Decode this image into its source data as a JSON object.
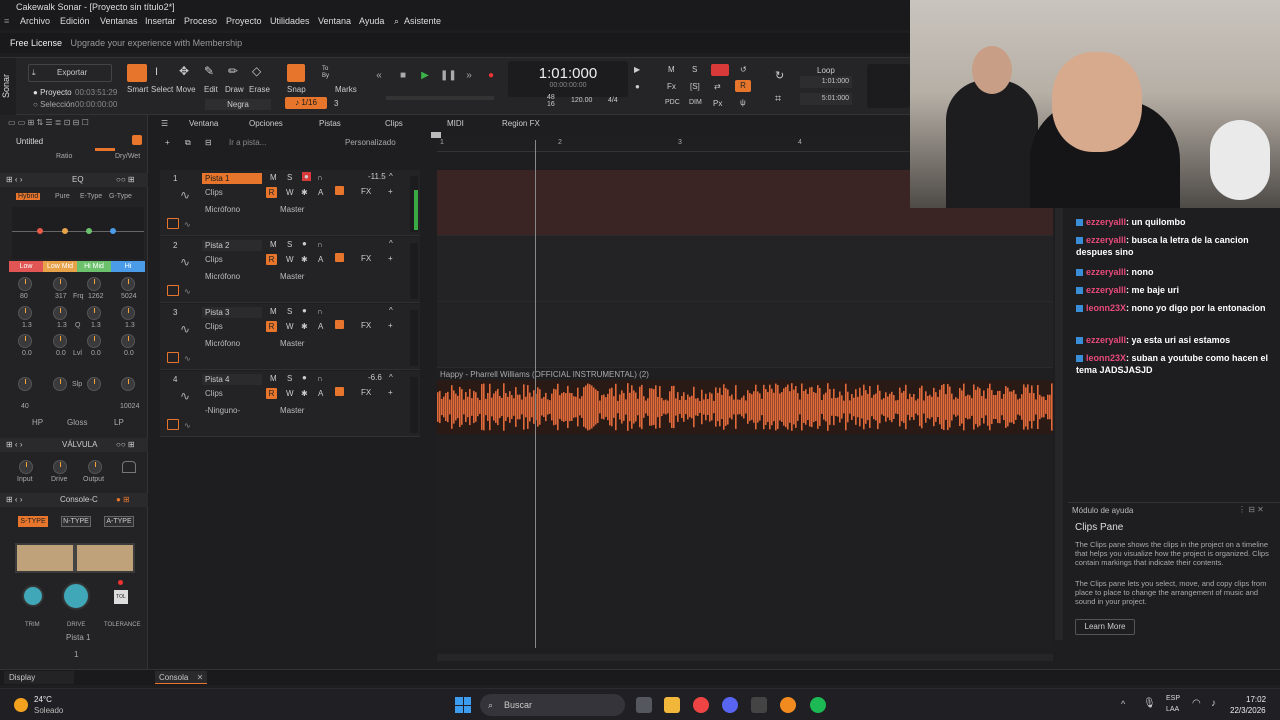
{
  "app": {
    "title": "Cakewalk Sonar - [Proyecto sin título2*]",
    "menu": [
      "Archivo",
      "Edición",
      "Ventanas",
      "Insertar",
      "Proceso",
      "Proyecto",
      "Utilidades",
      "Ventana",
      "Ayuda",
      "Asistente"
    ],
    "license_main": "Free License",
    "license_sub": "Upgrade your experience with Membership",
    "side_logo": "Sonar"
  },
  "controlbar": {
    "export_label": "Exportar",
    "project_label": "Proyecto",
    "project_time": "00:03:51:29",
    "selection_label": "Selección",
    "selection_time": "00:00:00:00",
    "tools": [
      "Smart",
      "Select",
      "Move",
      "Edit",
      "Draw",
      "Erase"
    ],
    "tool_mode": "Negra",
    "snap_label": "Snap",
    "snap_value": "1/16",
    "marks_label": "Marks",
    "to_by": "To",
    "by": "By",
    "snap_count": "3",
    "time_main": "1:01:000",
    "time_sub": "00:00:00:00",
    "tempo": "120.00",
    "timesig": "4/4",
    "meter_top": "48",
    "meter_bottom": "16",
    "loop_label": "Loop",
    "loop_start": "1:01:000",
    "loop_end": "5:01:000",
    "m_label": "M",
    "s_label": "S",
    "r_label": "R",
    "pdc_label": "PDC",
    "dim_label": "DIM",
    "px_label": "Px",
    "fx_label": "Fx",
    "s_bracket": "[S]"
  },
  "inspector": {
    "preset": "Untitled",
    "ratio_label": "Ratio",
    "drywet_label": "Dry/Wet",
    "eq_title": "EQ",
    "eq_modes": [
      "Hybrid",
      "Pure",
      "E-Type",
      "G-Type"
    ],
    "bands": [
      "Low",
      "Low Mid",
      "Hi Mid",
      "Hi"
    ],
    "band_vals_1": [
      "80",
      "317",
      "1262",
      "5024"
    ],
    "band_lbl_1": "Frq",
    "band_vals_2": [
      "1.3",
      "1.3",
      "1.3",
      "1.3"
    ],
    "band_lbl_2": "Q",
    "band_vals_3": [
      "0.0",
      "0.0",
      "0.0",
      "0.0"
    ],
    "band_lbl_3": "Lvl",
    "slp_label": "Slp",
    "hp_val": "40",
    "lp_val": "10024",
    "filters": [
      "HP",
      "Gloss",
      "LP"
    ],
    "valve_title": "VÁLVULA",
    "valve_knobs": [
      "Input",
      "Drive",
      "Output"
    ],
    "console_title": "Console-C",
    "console_types": [
      "S-TYPE",
      "N-TYPE",
      "A-TYPE"
    ],
    "console_knobs": [
      "TRIM",
      "DRIVE",
      "TOLERANCE"
    ],
    "tol_label": "TOL",
    "track_name": "Pista 1",
    "track_num": "1",
    "display_label": "Display"
  },
  "trackview": {
    "menu": [
      "Ventana",
      "Opciones",
      "Pistas",
      "Clips",
      "MIDI",
      "Region FX"
    ],
    "goto_placeholder": "Ir a pista...",
    "preset": "Personalizado",
    "ruler_marks": [
      "1",
      "2",
      "3",
      "4"
    ],
    "tracks": [
      {
        "num": "1",
        "name": "Pista 1",
        "level": "-11.5",
        "type": "Clips",
        "input": "Micrófono",
        "output": "Master"
      },
      {
        "num": "2",
        "name": "Pista 2",
        "level": "",
        "type": "Clips",
        "input": "Micrófono",
        "output": "Master"
      },
      {
        "num": "3",
        "name": "Pista 3",
        "level": "",
        "type": "Clips",
        "input": "Micrófono",
        "output": "Master"
      },
      {
        "num": "4",
        "name": "Pista 4",
        "level": "-6.6",
        "type": "Clips",
        "input": "-Ninguno-",
        "output": "Master"
      }
    ],
    "btn_m": "M",
    "btn_s": "S",
    "btn_r": "R",
    "btn_w": "W",
    "btn_a": "A",
    "btn_fx": "FX",
    "clip_name": "Happy - Pharrell Williams (OFFICIAL INSTRUMENTAL) (2)"
  },
  "chat": [
    {
      "user": "ezzeryalll",
      "msg": ": un quilombo"
    },
    {
      "user": "ezzeryalll",
      "msg": ": busca la letra de la cancion despues sino"
    },
    {
      "user": "ezzeryalll",
      "msg": ": nono"
    },
    {
      "user": "ezzeryalll",
      "msg": ": me baje uri"
    },
    {
      "user": "leonn23X",
      "msg": ": nono yo digo por la entonacion"
    },
    {
      "user": "ezzeryalll",
      "msg": ": ya esta uri asi estamos"
    },
    {
      "user": "leonn23X",
      "msg": ": suban a youtube como hacen el tema JADSJASJD"
    }
  ],
  "help": {
    "header": "Módulo de ayuda",
    "title": "Clips Pane",
    "p1": "The Clips pane shows the clips in the project on a timeline that helps you visualize how the project is organized. Clips contain markings that indicate their contents.",
    "p2": "The Clips pane lets you select, move, and copy clips from place to place to change the arrangement of music and sound in your project.",
    "learn_more": "Learn More"
  },
  "bottom": {
    "console_tab": "Consola"
  },
  "taskbar": {
    "weather_temp": "24°C",
    "weather_desc": "Soleado",
    "search": "Buscar",
    "lang1": "ESP",
    "lang2": "LAA",
    "time": "17:02",
    "date": "22/3/2026"
  }
}
